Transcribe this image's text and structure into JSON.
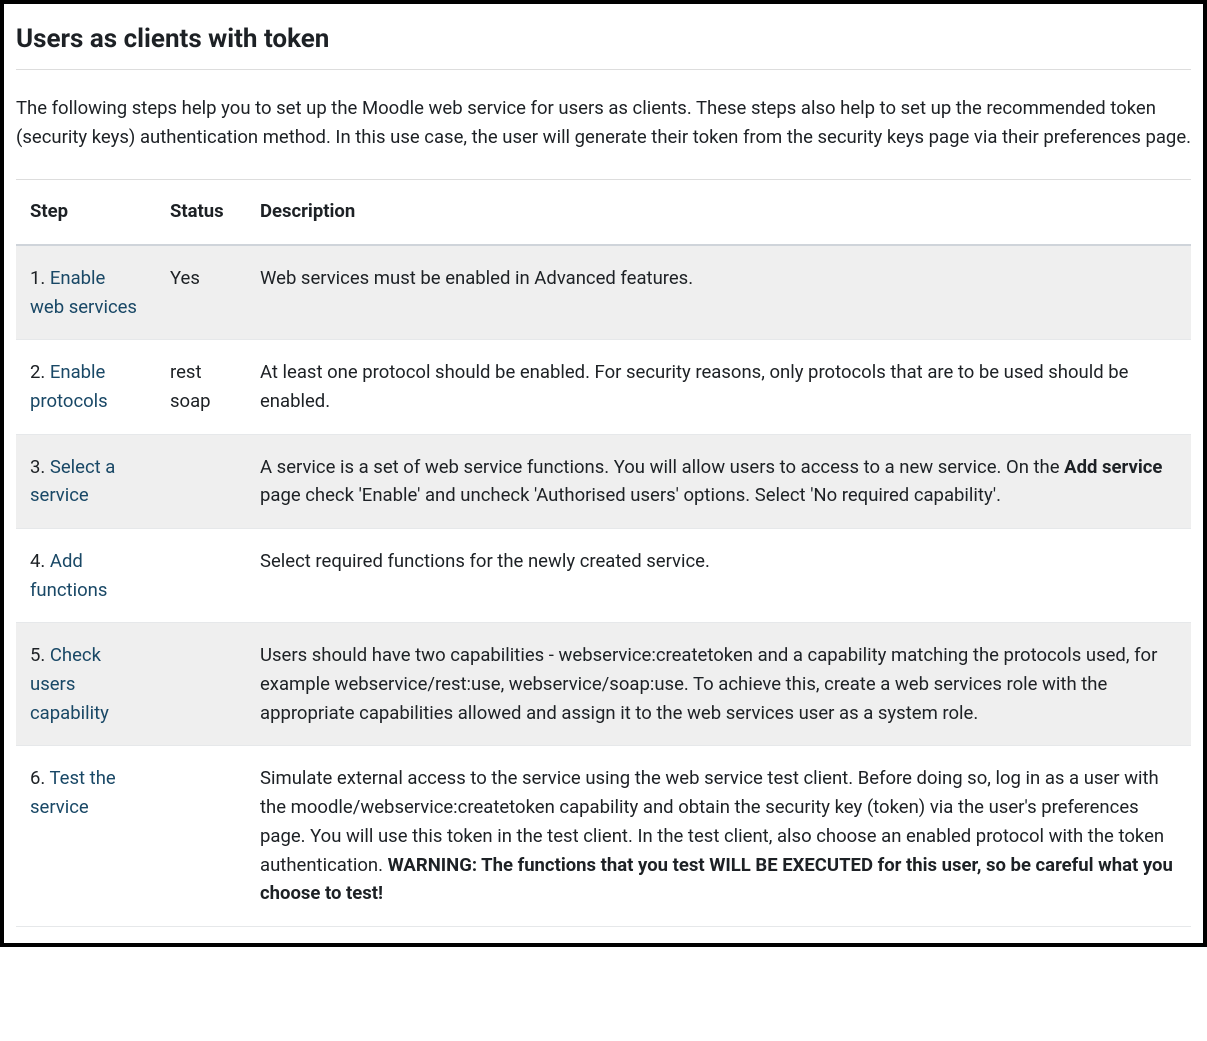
{
  "header": {
    "title": "Users as clients with token"
  },
  "intro": "The following steps help you to set up the Moodle web service for users as clients. These steps also help to set up the recommended token (security keys) authentication method. In this use case, the user will generate their token from the security keys page via their preferences page.",
  "table": {
    "headers": {
      "step": "Step",
      "status": "Status",
      "description": "Description"
    },
    "rows": [
      {
        "num": "1. ",
        "link": "Enable web services",
        "status": "Yes",
        "desc_pre": "Web services must be enabled in Advanced features.",
        "desc_bold": "",
        "desc_post": ""
      },
      {
        "num": "2. ",
        "link": "Enable protocols",
        "status": "rest soap",
        "desc_pre": "At least one protocol should be enabled. For security reasons, only protocols that are to be used should be enabled.",
        "desc_bold": "",
        "desc_post": ""
      },
      {
        "num": "3. ",
        "link": "Select a service",
        "status": "",
        "desc_pre": "A service is a set of web service functions. You will allow users to access to a new service. On the ",
        "desc_bold": "Add service",
        "desc_post": " page check 'Enable' and uncheck 'Authorised users' options. Select 'No required capability'."
      },
      {
        "num": "4. ",
        "link": "Add functions",
        "status": "",
        "desc_pre": "Select required functions for the newly created service.",
        "desc_bold": "",
        "desc_post": ""
      },
      {
        "num": "5. ",
        "link": "Check users capability",
        "status": "",
        "desc_pre": "Users should have two capabilities - webservice:createtoken and a capability matching the protocols used, for example webservice/rest:use, webservice/soap:use. To achieve this, create a web services role with the appropriate capabilities allowed and assign it to the web services user as a system role.",
        "desc_bold": "",
        "desc_post": ""
      },
      {
        "num": "6. ",
        "link": "Test the service",
        "status": "",
        "desc_pre": "Simulate external access to the service using the web service test client. Before doing so, log in as a user with the moodle/webservice:createtoken capability and obtain the security key (token) via the user's preferences page. You will use this token in the test client. In the test client, also choose an enabled protocol with the token authentication. ",
        "desc_bold": "WARNING: The functions that you test WILL BE EXECUTED for this user, so be careful what you choose to test!",
        "desc_post": ""
      }
    ]
  }
}
